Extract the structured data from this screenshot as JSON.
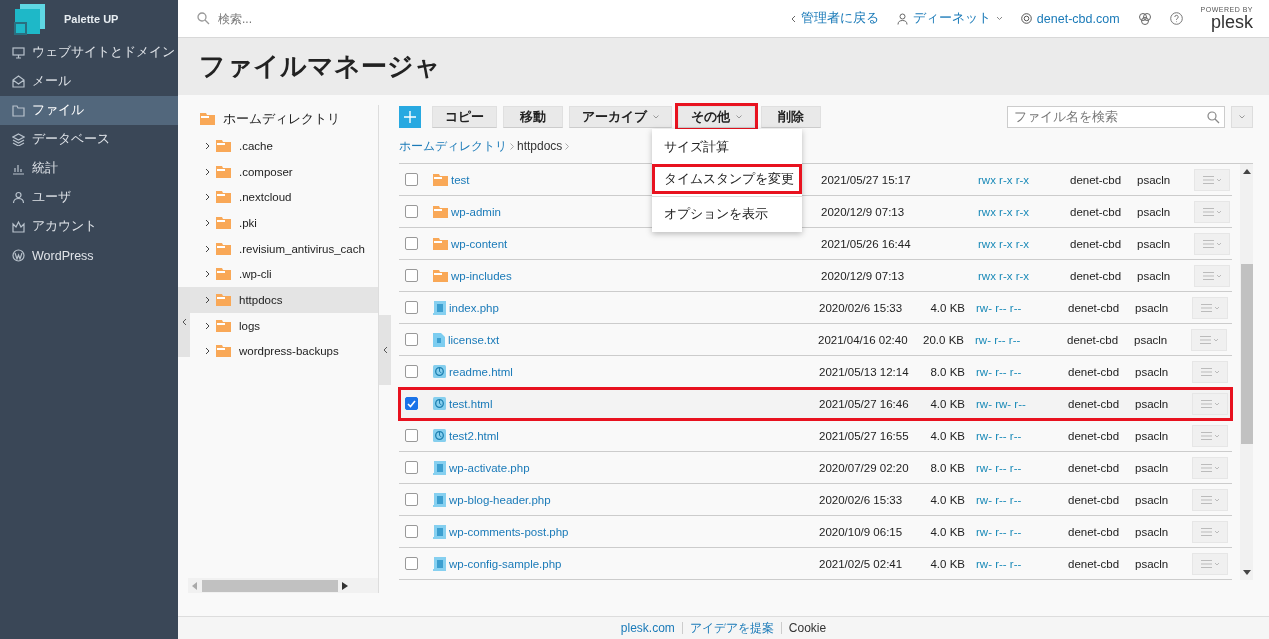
{
  "brand": {
    "name": "Palette UP"
  },
  "sidebar": {
    "items": [
      {
        "label": "ウェブサイトとドメイン",
        "selected": false
      },
      {
        "label": "メール",
        "selected": false
      },
      {
        "label": "ファイル",
        "selected": true
      },
      {
        "label": "データベース",
        "selected": false
      },
      {
        "label": "統計",
        "selected": false
      },
      {
        "label": "ユーザ",
        "selected": false
      },
      {
        "label": "アカウント",
        "selected": false
      },
      {
        "label": "WordPress",
        "selected": false
      }
    ]
  },
  "topbar": {
    "search": {
      "placeholder": "検索..."
    },
    "back_link": "管理者に戻る",
    "user": "ディーネット",
    "domain": "denet-cbd.com",
    "powered_by": "POWERED BY",
    "product": "plesk"
  },
  "page_title": "ファイルマネージャ",
  "tree": {
    "root": {
      "label": "ホームディレクトリ",
      "selected": false,
      "children": [
        {
          "label": ".cache",
          "selected": false,
          "expanded": false
        },
        {
          "label": ".composer",
          "selected": false,
          "expanded": false
        },
        {
          "label": ".nextcloud",
          "selected": false,
          "expanded": false
        },
        {
          "label": ".pki",
          "selected": false,
          "expanded": false
        },
        {
          "label": ".revisium_antivirus_cach",
          "selected": false,
          "expanded": false
        },
        {
          "label": ".wp-cli",
          "selected": false,
          "expanded": false
        },
        {
          "label": "httpdocs",
          "selected": true,
          "expanded": false
        },
        {
          "label": "logs",
          "selected": false,
          "expanded": false
        },
        {
          "label": "wordpress-backups",
          "selected": false,
          "expanded": false
        }
      ]
    }
  },
  "toolbar": {
    "buttons": [
      {
        "label": "コピー",
        "dropdown": false,
        "highlighted": false
      },
      {
        "label": "移動",
        "dropdown": false,
        "highlighted": false
      },
      {
        "label": "アーカイブ",
        "dropdown": true,
        "highlighted": false
      },
      {
        "label": "その他",
        "dropdown": true,
        "highlighted": true
      },
      {
        "label": "削除",
        "dropdown": false,
        "highlighted": false
      }
    ],
    "search": {
      "placeholder": "ファイル名を検索"
    }
  },
  "menu": {
    "items": [
      {
        "label": "サイズ計算",
        "highlighted": false
      },
      {
        "label": "タイムスタンプを変更",
        "highlighted": true
      },
      {
        "label": "オプションを表示",
        "highlighted": false
      }
    ]
  },
  "breadcrumb": [
    {
      "label": "ホームディレクトリ",
      "kind": "link"
    },
    {
      "label": "httpdocs",
      "kind": "current"
    }
  ],
  "files": [
    {
      "kind": "folder",
      "name": "test",
      "modified": "2021/05/27 15:17",
      "permissions": "rwx r-x r-x",
      "user": "denet-cbd",
      "group": "psacln",
      "checked": false,
      "highlighted": false
    },
    {
      "kind": "folder",
      "name": "wp-admin",
      "modified": "2020/12/9 07:13",
      "permissions": "rwx r-x r-x",
      "user": "denet-cbd",
      "group": "psacln",
      "checked": false,
      "highlighted": false
    },
    {
      "kind": "folder",
      "name": "wp-content",
      "modified": "2021/05/26 16:44",
      "permissions": "rwx r-x r-x",
      "user": "denet-cbd",
      "group": "psacln",
      "checked": false,
      "highlighted": false
    },
    {
      "kind": "folder",
      "name": "wp-includes",
      "modified": "2020/12/9 07:13",
      "permissions": "rwx r-x r-x",
      "user": "denet-cbd",
      "group": "psacln",
      "checked": false,
      "highlighted": false
    },
    {
      "kind": "script",
      "name": "index.php",
      "modified": "2020/02/6 15:33",
      "size": "4.0 KB",
      "permissions": "rw- r-- r--",
      "user": "denet-cbd",
      "group": "psacln",
      "checked": false,
      "highlighted": false
    },
    {
      "kind": "text",
      "name": "license.txt",
      "modified": "2021/04/16 02:40",
      "size": "20.0 KB",
      "permissions": "rw- r-- r--",
      "user": "denet-cbd",
      "group": "psacln",
      "checked": false,
      "highlighted": false
    },
    {
      "kind": "web",
      "name": "readme.html",
      "modified": "2021/05/13 12:14",
      "size": "8.0 KB",
      "permissions": "rw- r-- r--",
      "user": "denet-cbd",
      "group": "psacln",
      "checked": false,
      "highlighted": false
    },
    {
      "kind": "web",
      "name": "test.html",
      "modified": "2021/05/27 16:46",
      "size": "4.0 KB",
      "permissions": "rw- rw- r--",
      "user": "denet-cbd",
      "group": "psacln",
      "checked": true,
      "highlighted": true
    },
    {
      "kind": "web",
      "name": "test2.html",
      "modified": "2021/05/27 16:55",
      "size": "4.0 KB",
      "permissions": "rw- r-- r--",
      "user": "denet-cbd",
      "group": "psacln",
      "checked": false,
      "highlighted": false
    },
    {
      "kind": "script",
      "name": "wp-activate.php",
      "modified": "2020/07/29 02:20",
      "size": "8.0 KB",
      "permissions": "rw- r-- r--",
      "user": "denet-cbd",
      "group": "psacln",
      "checked": false,
      "highlighted": false
    },
    {
      "kind": "script",
      "name": "wp-blog-header.php",
      "modified": "2020/02/6 15:33",
      "size": "4.0 KB",
      "permissions": "rw- r-- r--",
      "user": "denet-cbd",
      "group": "psacln",
      "checked": false,
      "highlighted": false
    },
    {
      "kind": "script",
      "name": "wp-comments-post.php",
      "modified": "2020/10/9 06:15",
      "size": "4.0 KB",
      "permissions": "rw- r-- r--",
      "user": "denet-cbd",
      "group": "psacln",
      "checked": false,
      "highlighted": false
    },
    {
      "kind": "script",
      "name": "wp-config-sample.php",
      "modified": "2021/02/5 02:41",
      "size": "4.0 KB",
      "permissions": "rw- r-- r--",
      "user": "denet-cbd",
      "group": "psacln",
      "checked": false,
      "highlighted": false
    }
  ],
  "footer": {
    "links": [
      "plesk.com",
      "アイデアを提案",
      "Cookie"
    ]
  }
}
